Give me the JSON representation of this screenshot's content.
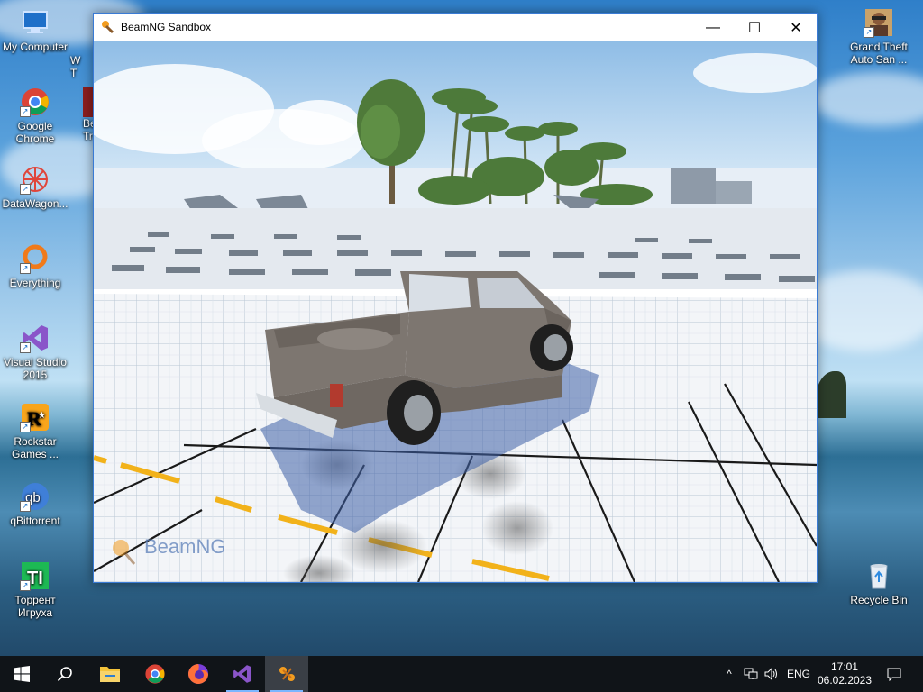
{
  "desktop": {
    "icons_left": [
      {
        "label": "My Computer",
        "icon": "computer-icon"
      },
      {
        "label": "Google Chrome",
        "icon": "chrome-icon"
      },
      {
        "label": "DataWagon...",
        "icon": "datawagon-icon"
      },
      {
        "label": "Everything",
        "icon": "everything-icon"
      },
      {
        "label": "Visual Studio 2015",
        "icon": "visual-studio-icon"
      },
      {
        "label": "Rockstar Games ...",
        "icon": "rockstar-icon"
      },
      {
        "label": "qBittorrent",
        "icon": "qbittorrent-icon"
      },
      {
        "label": "Торрент Игруха",
        "icon": "torrent-igruha-icon"
      }
    ],
    "icons_right": [
      {
        "label": "Grand Theft Auto San ...",
        "icon": "gta-icon"
      },
      {
        "label": "Recycle Bin",
        "icon": "recycle-bin-icon"
      }
    ],
    "partial_icons": [
      {
        "label": "W\nT"
      },
      {
        "label": "Be\nTr"
      }
    ]
  },
  "window": {
    "title": "BeamNG Sandbox",
    "minimize": "—",
    "maximize": "☐",
    "close": "✕",
    "game": {
      "watermark": "BeamNG",
      "vehicle": "pickup truck"
    }
  },
  "taskbar": {
    "start": "start-icon",
    "search": "search-icon",
    "apps": [
      "file-explorer-icon",
      "chrome-icon",
      "firefox-icon",
      "visual-studio-icon",
      "beamng-icon"
    ],
    "tray": {
      "chevron": "^",
      "language": "ENG",
      "time": "17:01",
      "date": "06.02.2023"
    }
  },
  "colors": {
    "taskbar_bg": "#101418",
    "accent": "#3a7bd5",
    "truck": "#7d7670",
    "road_marking": "#f2b21a"
  }
}
